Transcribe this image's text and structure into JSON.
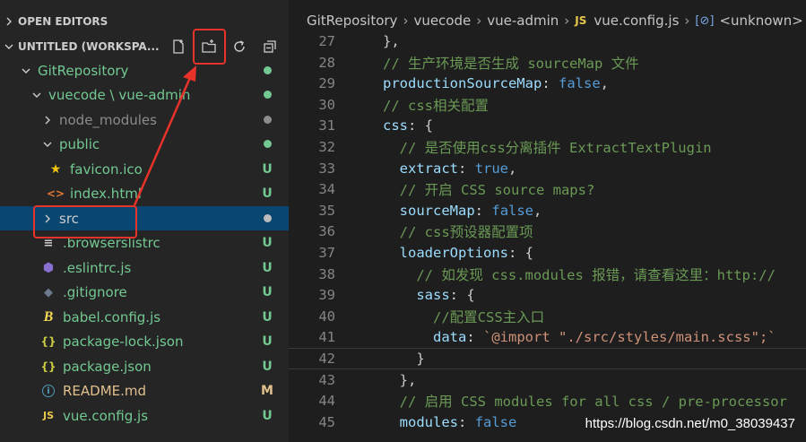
{
  "explorer": {
    "open_editors_label": "OPEN EDITORS",
    "workspace_label": "UNTITLED (WORKSPA...",
    "tree": [
      {
        "label": "GitRepository",
        "kind": "folder-open",
        "icon": "chevron-down",
        "status": "dot",
        "color": "#73c991"
      },
      {
        "label": "vuecode \\ vue-admin",
        "kind": "folder-open",
        "icon": "chevron-down",
        "status": "dot",
        "color": "#73c991"
      },
      {
        "label": "node_modules",
        "kind": "folder",
        "icon": "chevron-right",
        "status": "dot",
        "color": "#8c8c8c"
      },
      {
        "label": "public",
        "kind": "folder-open",
        "icon": "chevron-down",
        "status": "dot",
        "color": "#73c991"
      },
      {
        "label": "favicon.ico",
        "kind": "file",
        "icon": "star-icon",
        "status": "U",
        "color": "#73c991"
      },
      {
        "label": "index.html",
        "kind": "file",
        "icon": "html-icon",
        "status": "U",
        "color": "#73c991"
      },
      {
        "label": "src",
        "kind": "folder",
        "icon": "chevron-right",
        "status": "dot",
        "color": "#cccccc"
      },
      {
        "label": ".browserslistrc",
        "kind": "file",
        "icon": "list-icon",
        "status": "U",
        "color": "#73c991"
      },
      {
        "label": ".eslintrc.js",
        "kind": "file",
        "icon": "eslint-icon",
        "status": "U",
        "color": "#73c991"
      },
      {
        "label": ".gitignore",
        "kind": "file",
        "icon": "git-icon",
        "status": "U",
        "color": "#73c991"
      },
      {
        "label": "babel.config.js",
        "kind": "file",
        "icon": "babel-icon",
        "status": "U",
        "color": "#73c991"
      },
      {
        "label": "package-lock.json",
        "kind": "file",
        "icon": "json-icon",
        "status": "U",
        "color": "#73c991"
      },
      {
        "label": "package.json",
        "kind": "file",
        "icon": "json-icon",
        "status": "U",
        "color": "#73c991"
      },
      {
        "label": "README.md",
        "kind": "file",
        "icon": "info-icon",
        "status": "M",
        "color": "#e2c08d"
      },
      {
        "label": "vue.config.js",
        "kind": "file",
        "icon": "js-icon",
        "status": "U",
        "color": "#73c991"
      }
    ]
  },
  "breadcrumbs": {
    "items": [
      "GitRepository",
      "vuecode",
      "vue-admin"
    ],
    "file": "vue.config.js",
    "file_badge": "JS",
    "symbol": "<unknown>",
    "symbol_icon": "[⊘]"
  },
  "code": {
    "lines": [
      {
        "n": "27",
        "t": "},"
      },
      {
        "n": "28",
        "t": "// 生产环境是否生成 sourceMap 文件"
      },
      {
        "n": "29",
        "t": "productionSourceMap: false,"
      },
      {
        "n": "30",
        "t": "// css相关配置"
      },
      {
        "n": "31",
        "t": "css: {"
      },
      {
        "n": "32",
        "t": "  // 是否使用css分离插件 ExtractTextPlugin"
      },
      {
        "n": "33",
        "t": "  extract: true,"
      },
      {
        "n": "34",
        "t": "  // 开启 CSS source maps?"
      },
      {
        "n": "35",
        "t": "  sourceMap: false,"
      },
      {
        "n": "36",
        "t": "  // css预设器配置项"
      },
      {
        "n": "37",
        "t": "  loaderOptions: {"
      },
      {
        "n": "38",
        "t": "    // 如发现 css.modules 报错，请查看这里：http://"
      },
      {
        "n": "39",
        "t": "    sass: {"
      },
      {
        "n": "40",
        "t": "      //配置CSS主入口"
      },
      {
        "n": "41",
        "t": "      data: `@import \"./src/styles/main.scss\";`"
      },
      {
        "n": "42",
        "t": "    }"
      },
      {
        "n": "43",
        "t": "  },"
      },
      {
        "n": "44",
        "t": "  // 启用 CSS modules for all css / pre-processor"
      },
      {
        "n": "45",
        "t": "  modules: false"
      }
    ]
  },
  "watermark": "https://blog.csdn.net/m0_38039437",
  "colors": {
    "annotation": "#e8332a",
    "selection": "#094771",
    "untracked": "#73c991",
    "modified": "#e2c08d"
  }
}
